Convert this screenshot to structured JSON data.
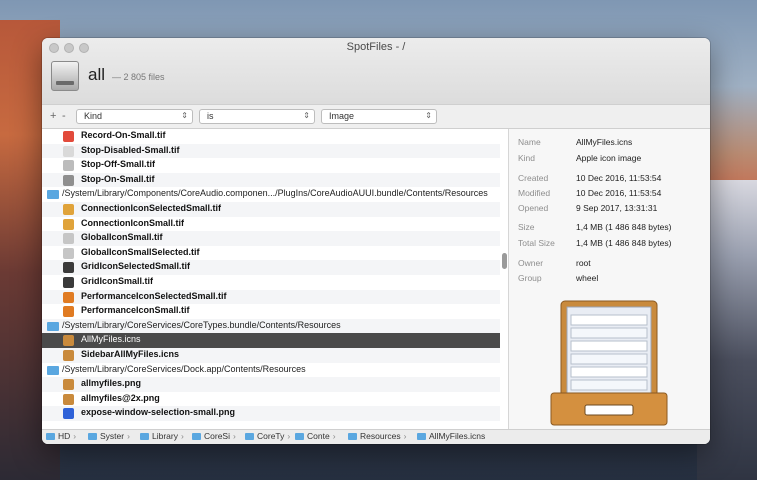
{
  "window": {
    "title": "SpotFiles - /"
  },
  "header": {
    "scope": "all",
    "count_text": "— 2 805 files"
  },
  "filter": {
    "add": "+",
    "remove": "-",
    "field": "Kind",
    "operator": "is",
    "value": "Image"
  },
  "list": {
    "rows": [
      {
        "type": "file",
        "name": "Record-On-Small.tif",
        "icon": "record-icon"
      },
      {
        "type": "file",
        "name": "Stop-Disabled-Small.tif",
        "icon": "stop-disabled-icon"
      },
      {
        "type": "file",
        "name": "Stop-Off-Small.tif",
        "icon": "stop-off-icon"
      },
      {
        "type": "file",
        "name": "Stop-On-Small.tif",
        "icon": "stop-on-icon"
      },
      {
        "type": "folder",
        "name": "/System/Library/Components/CoreAudio.componen.../PlugIns/CoreAudioAUUI.bundle/Contents/Resources"
      },
      {
        "type": "file",
        "name": "ConnectionIconSelectedSmall.tif",
        "icon": "connection-icon"
      },
      {
        "type": "file",
        "name": "ConnectionIconSmall.tif",
        "icon": "connection-icon"
      },
      {
        "type": "file",
        "name": "GlobalIconSmall.tif",
        "icon": "global-icon"
      },
      {
        "type": "file",
        "name": "GlobalIconSmallSelected.tif",
        "icon": "global-icon"
      },
      {
        "type": "file",
        "name": "GridIconSelectedSmall.tif",
        "icon": "grid-icon"
      },
      {
        "type": "file",
        "name": "GridIconSmall.tif",
        "icon": "grid-icon"
      },
      {
        "type": "file",
        "name": "PerformanceIconSelectedSmall.tif",
        "icon": "performance-icon"
      },
      {
        "type": "file",
        "name": "PerformanceIconSmall.tif",
        "icon": "performance-icon"
      },
      {
        "type": "folder",
        "name": "/System/Library/CoreServices/CoreTypes.bundle/Contents/Resources"
      },
      {
        "type": "file",
        "name": "AllMyFiles.icns",
        "icon": "allmyfiles-icon",
        "selected": true
      },
      {
        "type": "file",
        "name": "SidebarAllMyFiles.icns",
        "icon": "allmyfiles-icon"
      },
      {
        "type": "folder",
        "name": "/System/Library/CoreServices/Dock.app/Contents/Resources"
      },
      {
        "type": "file",
        "name": "allmyfiles.png",
        "icon": "allmyfiles-icon"
      },
      {
        "type": "file",
        "name": "allmyfiles@2x.png",
        "icon": "allmyfiles-icon"
      },
      {
        "type": "file",
        "name": "expose-window-selection-small.png",
        "icon": "expose-icon"
      }
    ]
  },
  "info": {
    "fields": [
      {
        "label": "Name",
        "value": "AllMyFiles.icns"
      },
      {
        "label": "Kind",
        "value": "Apple icon image"
      },
      {
        "label": "Created",
        "value": "10 Dec 2016, 11:53:54"
      },
      {
        "label": "Modified",
        "value": "10 Dec 2016, 11:53:54"
      },
      {
        "label": "Opened",
        "value": "9 Sep 2017, 13:31:31"
      },
      {
        "label": "Size",
        "value": "1,4 MB (1 486 848 bytes)"
      },
      {
        "label": "Total Size",
        "value": "1,4 MB (1 486 848 bytes)"
      },
      {
        "label": "Owner",
        "value": "root"
      },
      {
        "label": "Group",
        "value": "wheel"
      }
    ],
    "preview_icon": "file-drawer-icon"
  },
  "pathbar": {
    "items": [
      "HD",
      "Syster",
      "Library",
      "CoreSi",
      "CoreTy",
      "Conte",
      "Resources",
      "AllMyFiles.icns"
    ]
  },
  "colors": {
    "highlight": "#f6ea2a",
    "selection": "#4a4a4a",
    "folder": "#5aa7e0"
  }
}
